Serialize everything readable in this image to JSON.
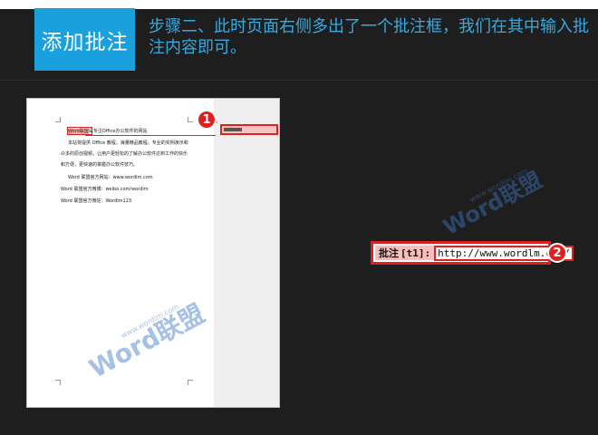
{
  "header": {
    "title": "添加批注",
    "subtitle": "步骤二、此时页面右侧多出了一个批注框，我们在其中输入批注内容即可。"
  },
  "document": {
    "lines": [
      {
        "text": "Word联盟是专注Office办公软件的网站",
        "highlight": "Word联盟"
      },
      {
        "text": "本站将提供 Office 教程，海量精品教程，专业的实例演示和"
      },
      {
        "text": "众多的原创视频，让用户更轻松的了解办公软件达到工作的快乐"
      },
      {
        "text": "和方便，更快速的掌握办公软件技巧。"
      },
      {
        "text": "Word 联盟官方网站：www.wordlm.com"
      },
      {
        "text": "Word 联盟官方微博：weibo.com/wordlm"
      },
      {
        "text": "Word 联盟官方微信：Wordlm123"
      }
    ]
  },
  "markers": {
    "one": "1",
    "two": "2"
  },
  "comment": {
    "label": "批注",
    "tag": "[t1]:",
    "value": "http://www.wordlm.com/"
  },
  "watermark": {
    "brand": "Word联盟",
    "site": "www.wordlm.com"
  },
  "colors": {
    "accent": "#1aa0dc",
    "highlight_red": "#e0201f",
    "comment_fill": "#f7bcbc"
  }
}
